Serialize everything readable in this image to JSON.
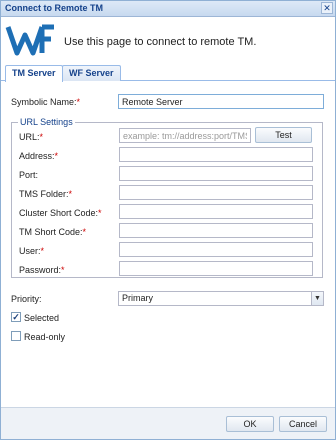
{
  "window": {
    "title": "Connect to Remote TM"
  },
  "banner": {
    "logo_text": "WF",
    "message": "Use this page to connect to remote TM."
  },
  "tabs": [
    {
      "label": "TM Server"
    },
    {
      "label": "WF Server"
    }
  ],
  "form": {
    "symbolic_name": {
      "label": "Symbolic Name:",
      "required": "*",
      "value": "Remote Server"
    },
    "url_settings": {
      "legend": "URL Settings",
      "url": {
        "label": "URL:",
        "required": "*",
        "placeholder": "example: tm://address:port/TMS"
      },
      "test_button": "Test",
      "address": {
        "label": "Address:",
        "required": "*"
      },
      "port": {
        "label": "Port:"
      },
      "tms_folder": {
        "label": "TMS Folder:",
        "required": "*"
      },
      "cluster_short_code": {
        "label": "Cluster Short Code:",
        "required": "*"
      },
      "tm_short_code": {
        "label": "TM Short Code:",
        "required": "*"
      },
      "user": {
        "label": "User:",
        "required": "*"
      },
      "password": {
        "label": "Password:",
        "required": "*"
      }
    },
    "priority": {
      "label": "Priority:",
      "value": "Primary"
    },
    "selected": {
      "label": "Selected",
      "checked": "✓"
    },
    "read_only": {
      "label": "Read-only"
    }
  },
  "footer": {
    "ok": "OK",
    "cancel": "Cancel"
  },
  "colors": {
    "accent": "#15428b",
    "required": "#cc0000",
    "logo": "#1e6fb5"
  },
  "icons": {
    "close": "close-icon",
    "dropdown": "chevron-down-icon",
    "check": "checkmark-icon"
  }
}
